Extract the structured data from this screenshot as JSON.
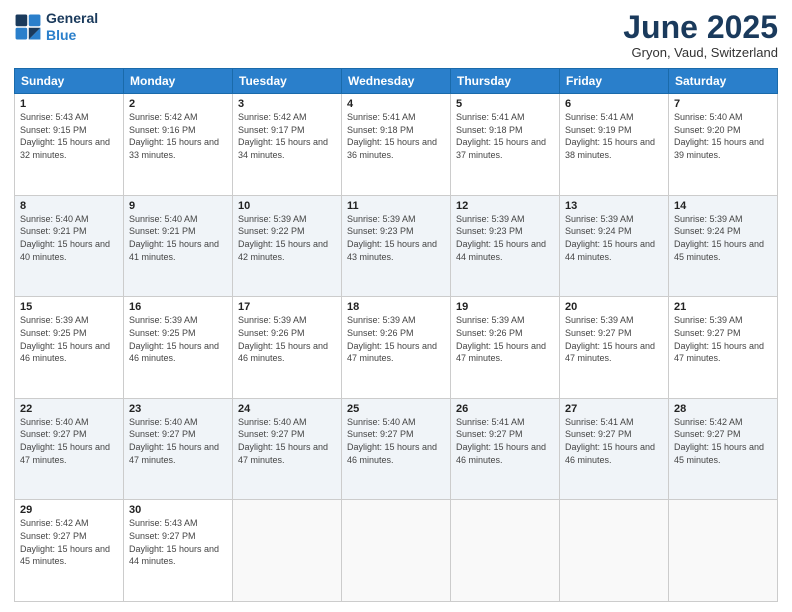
{
  "logo": {
    "line1": "General",
    "line2": "Blue"
  },
  "title": "June 2025",
  "location": "Gryon, Vaud, Switzerland",
  "weekdays": [
    "Sunday",
    "Monday",
    "Tuesday",
    "Wednesday",
    "Thursday",
    "Friday",
    "Saturday"
  ],
  "weeks": [
    [
      {
        "day": "1",
        "sunrise": "Sunrise: 5:43 AM",
        "sunset": "Sunset: 9:15 PM",
        "daylight": "Daylight: 15 hours and 32 minutes."
      },
      {
        "day": "2",
        "sunrise": "Sunrise: 5:42 AM",
        "sunset": "Sunset: 9:16 PM",
        "daylight": "Daylight: 15 hours and 33 minutes."
      },
      {
        "day": "3",
        "sunrise": "Sunrise: 5:42 AM",
        "sunset": "Sunset: 9:17 PM",
        "daylight": "Daylight: 15 hours and 34 minutes."
      },
      {
        "day": "4",
        "sunrise": "Sunrise: 5:41 AM",
        "sunset": "Sunset: 9:18 PM",
        "daylight": "Daylight: 15 hours and 36 minutes."
      },
      {
        "day": "5",
        "sunrise": "Sunrise: 5:41 AM",
        "sunset": "Sunset: 9:18 PM",
        "daylight": "Daylight: 15 hours and 37 minutes."
      },
      {
        "day": "6",
        "sunrise": "Sunrise: 5:41 AM",
        "sunset": "Sunset: 9:19 PM",
        "daylight": "Daylight: 15 hours and 38 minutes."
      },
      {
        "day": "7",
        "sunrise": "Sunrise: 5:40 AM",
        "sunset": "Sunset: 9:20 PM",
        "daylight": "Daylight: 15 hours and 39 minutes."
      }
    ],
    [
      {
        "day": "8",
        "sunrise": "Sunrise: 5:40 AM",
        "sunset": "Sunset: 9:21 PM",
        "daylight": "Daylight: 15 hours and 40 minutes."
      },
      {
        "day": "9",
        "sunrise": "Sunrise: 5:40 AM",
        "sunset": "Sunset: 9:21 PM",
        "daylight": "Daylight: 15 hours and 41 minutes."
      },
      {
        "day": "10",
        "sunrise": "Sunrise: 5:39 AM",
        "sunset": "Sunset: 9:22 PM",
        "daylight": "Daylight: 15 hours and 42 minutes."
      },
      {
        "day": "11",
        "sunrise": "Sunrise: 5:39 AM",
        "sunset": "Sunset: 9:23 PM",
        "daylight": "Daylight: 15 hours and 43 minutes."
      },
      {
        "day": "12",
        "sunrise": "Sunrise: 5:39 AM",
        "sunset": "Sunset: 9:23 PM",
        "daylight": "Daylight: 15 hours and 44 minutes."
      },
      {
        "day": "13",
        "sunrise": "Sunrise: 5:39 AM",
        "sunset": "Sunset: 9:24 PM",
        "daylight": "Daylight: 15 hours and 44 minutes."
      },
      {
        "day": "14",
        "sunrise": "Sunrise: 5:39 AM",
        "sunset": "Sunset: 9:24 PM",
        "daylight": "Daylight: 15 hours and 45 minutes."
      }
    ],
    [
      {
        "day": "15",
        "sunrise": "Sunrise: 5:39 AM",
        "sunset": "Sunset: 9:25 PM",
        "daylight": "Daylight: 15 hours and 46 minutes."
      },
      {
        "day": "16",
        "sunrise": "Sunrise: 5:39 AM",
        "sunset": "Sunset: 9:25 PM",
        "daylight": "Daylight: 15 hours and 46 minutes."
      },
      {
        "day": "17",
        "sunrise": "Sunrise: 5:39 AM",
        "sunset": "Sunset: 9:26 PM",
        "daylight": "Daylight: 15 hours and 46 minutes."
      },
      {
        "day": "18",
        "sunrise": "Sunrise: 5:39 AM",
        "sunset": "Sunset: 9:26 PM",
        "daylight": "Daylight: 15 hours and 47 minutes."
      },
      {
        "day": "19",
        "sunrise": "Sunrise: 5:39 AM",
        "sunset": "Sunset: 9:26 PM",
        "daylight": "Daylight: 15 hours and 47 minutes."
      },
      {
        "day": "20",
        "sunrise": "Sunrise: 5:39 AM",
        "sunset": "Sunset: 9:27 PM",
        "daylight": "Daylight: 15 hours and 47 minutes."
      },
      {
        "day": "21",
        "sunrise": "Sunrise: 5:39 AM",
        "sunset": "Sunset: 9:27 PM",
        "daylight": "Daylight: 15 hours and 47 minutes."
      }
    ],
    [
      {
        "day": "22",
        "sunrise": "Sunrise: 5:40 AM",
        "sunset": "Sunset: 9:27 PM",
        "daylight": "Daylight: 15 hours and 47 minutes."
      },
      {
        "day": "23",
        "sunrise": "Sunrise: 5:40 AM",
        "sunset": "Sunset: 9:27 PM",
        "daylight": "Daylight: 15 hours and 47 minutes."
      },
      {
        "day": "24",
        "sunrise": "Sunrise: 5:40 AM",
        "sunset": "Sunset: 9:27 PM",
        "daylight": "Daylight: 15 hours and 47 minutes."
      },
      {
        "day": "25",
        "sunrise": "Sunrise: 5:40 AM",
        "sunset": "Sunset: 9:27 PM",
        "daylight": "Daylight: 15 hours and 46 minutes."
      },
      {
        "day": "26",
        "sunrise": "Sunrise: 5:41 AM",
        "sunset": "Sunset: 9:27 PM",
        "daylight": "Daylight: 15 hours and 46 minutes."
      },
      {
        "day": "27",
        "sunrise": "Sunrise: 5:41 AM",
        "sunset": "Sunset: 9:27 PM",
        "daylight": "Daylight: 15 hours and 46 minutes."
      },
      {
        "day": "28",
        "sunrise": "Sunrise: 5:42 AM",
        "sunset": "Sunset: 9:27 PM",
        "daylight": "Daylight: 15 hours and 45 minutes."
      }
    ],
    [
      {
        "day": "29",
        "sunrise": "Sunrise: 5:42 AM",
        "sunset": "Sunset: 9:27 PM",
        "daylight": "Daylight: 15 hours and 45 minutes."
      },
      {
        "day": "30",
        "sunrise": "Sunrise: 5:43 AM",
        "sunset": "Sunset: 9:27 PM",
        "daylight": "Daylight: 15 hours and 44 minutes."
      },
      null,
      null,
      null,
      null,
      null
    ]
  ]
}
